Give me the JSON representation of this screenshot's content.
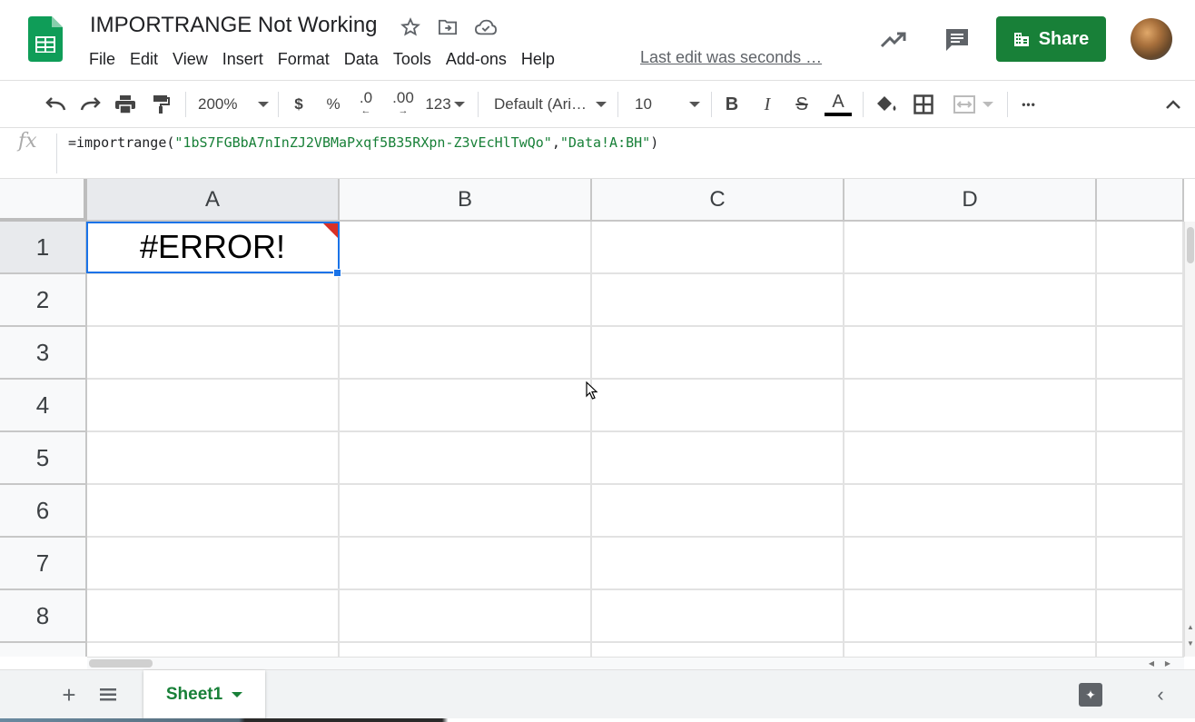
{
  "doc": {
    "title": "IMPORTRANGE Not Working",
    "last_edit": "Last edit was seconds …"
  },
  "menu": [
    "File",
    "Edit",
    "View",
    "Insert",
    "Format",
    "Data",
    "Tools",
    "Add-ons",
    "Help"
  ],
  "header_icons": [
    "star-icon",
    "move-folder-icon",
    "cloud-status-icon",
    "activity-trend-icon",
    "comments-icon"
  ],
  "share": {
    "label": "Share",
    "color": "#188038"
  },
  "toolbar": {
    "zoom": "200%",
    "currency": "$",
    "percent": "%",
    "decrease_decimal": ".0",
    "increase_decimal": ".00",
    "number_format": "123",
    "font": "Default (Ari…",
    "font_size": "10",
    "bold": "B",
    "italic": "I",
    "strike": "S",
    "text_color": "A",
    "more": "•••"
  },
  "formula_bar": {
    "fx_label": "fx",
    "prefix": "=importrange(",
    "arg1": "\"1bS7FGBbA7nInZJ2VBMaPxqf5B35RXpn-Z3vEcHlTwQo\"",
    "comma": ",",
    "arg2": "\"Data!A:BH\"",
    "suffix": ")"
  },
  "grid": {
    "columns": [
      "A",
      "B",
      "C",
      "D"
    ],
    "rows": [
      "1",
      "2",
      "3",
      "4",
      "5",
      "6",
      "7",
      "8"
    ],
    "selected_cell": "A1",
    "a1_value": "#ERROR!"
  },
  "sheets": [
    {
      "name": "Sheet1"
    }
  ],
  "colors": {
    "accent_green": "#188038",
    "selection_blue": "#1a73e8",
    "error_red": "#d93025"
  }
}
